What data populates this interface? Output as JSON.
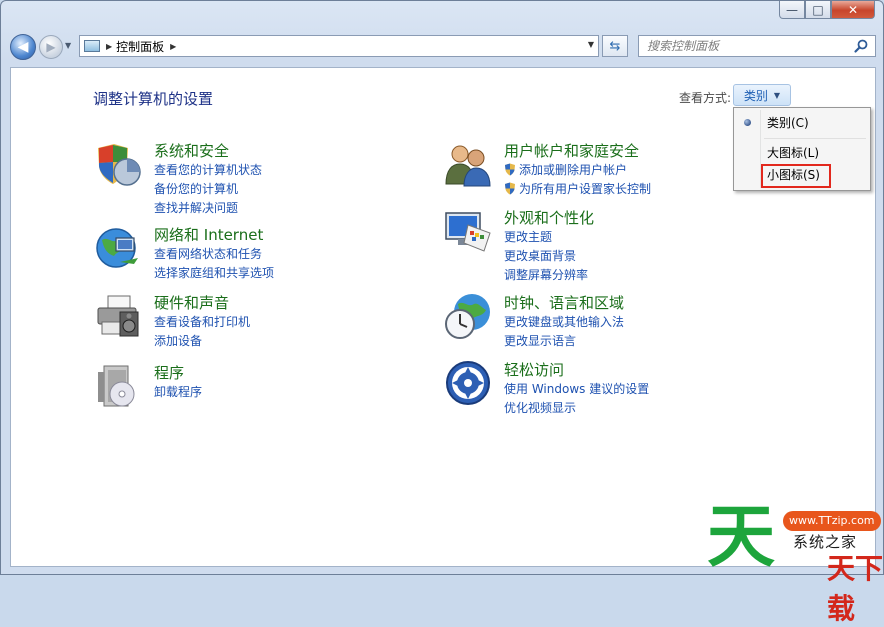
{
  "window": {
    "caption": {
      "minimize": "—",
      "maximize": "□",
      "close": "✕"
    }
  },
  "nav": {
    "back": "◀",
    "forward": "▶",
    "address": {
      "breadcrumb": "控制面板"
    },
    "search": {
      "placeholder": "搜索控制面板"
    }
  },
  "page": {
    "title": "调整计算机的设置",
    "view_by_label": "查看方式:",
    "view_by_value": "类别"
  },
  "categories": [
    {
      "title": "系统和安全",
      "icon": "system-security-icon",
      "links": [
        "查看您的计算机状态",
        "备份您的计算机",
        "查找并解决问题"
      ]
    },
    {
      "title": "网络和 Internet",
      "icon": "network-internet-icon",
      "links": [
        "查看网络状态和任务",
        "选择家庭组和共享选项"
      ]
    },
    {
      "title": "硬件和声音",
      "icon": "hardware-sound-icon",
      "links": [
        "查看设备和打印机",
        "添加设备"
      ]
    },
    {
      "title": "程序",
      "icon": "programs-icon",
      "links": [
        "卸载程序"
      ]
    },
    {
      "title": "用户帐户和家庭安全",
      "icon": "user-accounts-icon",
      "links": [
        "添加或删除用户帐户",
        "为所有用户设置家长控制"
      ]
    },
    {
      "title": "外观和个性化",
      "icon": "appearance-icon",
      "links": [
        "更改主题",
        "更改桌面背景",
        "调整屏幕分辨率"
      ]
    },
    {
      "title": "时钟、语言和区域",
      "icon": "clock-region-icon",
      "links": [
        "更改键盘或其他输入法",
        "更改显示语言"
      ]
    },
    {
      "title": "轻松访问",
      "icon": "ease-of-access-icon",
      "links": [
        "使用 Windows 建议的设置",
        "优化视频显示"
      ]
    }
  ],
  "view_menu": {
    "items": [
      "类别(C)",
      "大图标(L)",
      "小图标(S)"
    ],
    "selected": "类别(C)"
  },
  "watermark": {
    "big": "天",
    "url": "www.TTzip.com",
    "sub": "系统之家",
    "red": "天下载"
  },
  "colors": {
    "title_blue": "#1e3287",
    "category_green": "#1a6e1a",
    "link_blue": "#1f52b0",
    "highlight_red": "#e2281d"
  }
}
